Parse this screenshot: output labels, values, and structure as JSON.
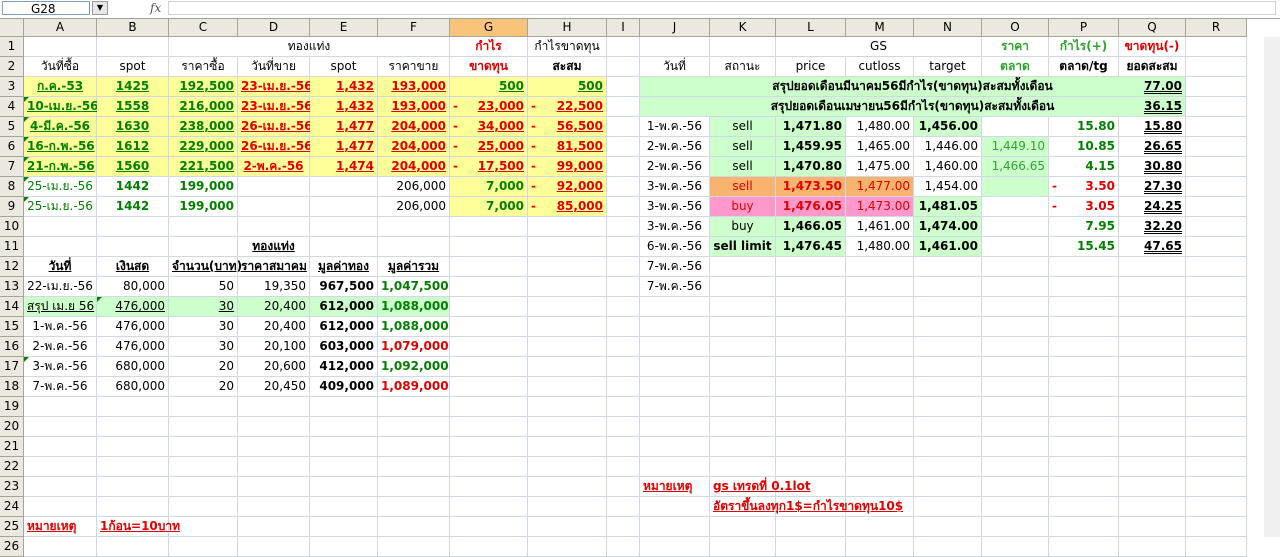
{
  "namebox": "G28",
  "fx": "fx",
  "columns": [
    "A",
    "B",
    "C",
    "D",
    "E",
    "F",
    "G",
    "H",
    "I",
    "J",
    "K",
    "L",
    "M",
    "N",
    "O",
    "P",
    "Q",
    "R"
  ],
  "rows": [
    "1",
    "2",
    "3",
    "4",
    "5",
    "6",
    "7",
    "8",
    "9",
    "10",
    "11",
    "12",
    "13",
    "14",
    "15",
    "16",
    "17",
    "18",
    "19",
    "20",
    "21",
    "22",
    "23",
    "24",
    "25",
    "26"
  ],
  "cells": {
    "C1": "ทองแท่ง",
    "G1": "กำไร",
    "H1": "กำไรขาดทุน",
    "L1": "GS",
    "O1": "ราคา",
    "P1": "กำไร(+)",
    "Q1": "ขาดทุน(-)",
    "A2": "วันที่ซื้อ",
    "B2": "spot",
    "C2": "ราคาซื้อ",
    "D2": "วันที่ขาย",
    "E2": "spot",
    "F2": "ราคาขาย",
    "G2": "ขาดทุน",
    "H2": "สะสม",
    "J2": "วันที่",
    "K2": "สถานะ",
    "L2": "price",
    "M2": "cutloss",
    "N2": "target",
    "O2": "ตลาด",
    "P2": "ตลาด/tg",
    "Q2": "ยอดสะสม",
    "A3": "ก.ค.-53",
    "B3": "1425",
    "C3": "192,500",
    "D3": "23-เม.ย.-56",
    "E3": "1,432",
    "F3": "193,000",
    "G3": "500",
    "H3": "500",
    "J3": "สรุปยอดเดือนมีนาคม56มีกำไร(ขาดทุน)สะสมทั้งเดือน",
    "Q3": "77.00",
    "A4": "10-เม.ย.-56",
    "B4": "1558",
    "C4": "216,000",
    "D4": "23-เม.ย.-56",
    "E4": "1,432",
    "F4": "193,000",
    "G4a": "-",
    "G4": "23,000",
    "H4a": "-",
    "H4": "22,500",
    "J4": "สรุปยอดเดือนเมษายน56มีกำไร(ขาดทุน)สะสมทั้งเดือน",
    "Q4": "36.15",
    "A5": "4-มี.ค.-56",
    "B5": "1630",
    "C5": "238,000",
    "D5": "26-เม.ย.-56",
    "E5": "1,477",
    "F5": "204,000",
    "G5a": "-",
    "G5": "34,000",
    "H5a": "-",
    "H5": "56,500",
    "J5": "1-พ.ค.-56",
    "K5": "sell",
    "L5": "1,471.80",
    "M5": "1,480.00",
    "N5": "1,456.00",
    "P5": "15.80",
    "Q5": "15.80",
    "A6": "16-ก.พ.-56",
    "B6": "1612",
    "C6": "229,000",
    "D6": "26-เม.ย.-56",
    "E6": "1,477",
    "F6": "204,000",
    "G6a": "-",
    "G6": "25,000",
    "H6a": "-",
    "H6": "81,500",
    "J6": "2-พ.ค.-56",
    "K6": "sell",
    "L6": "1,459.95",
    "M6": "1,465.00",
    "N6": "1,446.00",
    "O6": "1,449.10",
    "P6": "10.85",
    "Q6": "26.65",
    "A7": "21-ก.พ.-56",
    "B7": "1560",
    "C7": "221,500",
    "D7": "2-พ.ค.-56",
    "E7": "1,474",
    "F7": "204,000",
    "G7a": "-",
    "G7": "17,500",
    "H7a": "-",
    "H7": "99,000",
    "J7": "2-พ.ค.-56",
    "K7": "sell",
    "L7": "1,470.80",
    "M7": "1,475.00",
    "N7": "1,460.00",
    "O7": "1,466.65",
    "P7": "4.15",
    "Q7": "30.80",
    "A8": "25-เม.ย.-56",
    "B8": "1442",
    "C8": "199,000",
    "F8": "206,000",
    "G8": "7,000",
    "H8a": "-",
    "H8": "92,000",
    "J8": "3-พ.ค.-56",
    "K8": "sell",
    "L8": "1,473.50",
    "M8": "1,477.00",
    "N8": "1,454.00",
    "P8a": "-",
    "P8": "3.50",
    "Q8": "27.30",
    "A9": "25-เม.ย.-56",
    "B9": "1442",
    "C9": "199,000",
    "F9": "206,000",
    "G9": "7,000",
    "H9a": "-",
    "H9": "85,000",
    "J9": "3-พ.ค.-56",
    "K9": "buy",
    "L9": "1,476.05",
    "M9": "1,473.00",
    "N9": "1,481.05",
    "P9a": "-",
    "P9": "3.05",
    "Q9": "24.25",
    "J10": "3-พ.ค.-56",
    "K10": "buy",
    "L10": "1,466.05",
    "M10": "1,461.00",
    "N10": "1,474.00",
    "P10": "7.95",
    "Q10": "32.20",
    "D11": "ทองแท่ง",
    "J11": "6-พ.ค.-56",
    "K11": "sell limit",
    "L11": "1,476.45",
    "M11": "1,480.00",
    "N11": "1,461.00",
    "P11": "15.45",
    "Q11": "47.65",
    "A12": "วันที่",
    "B12": "เงินสด",
    "C12": "จำนวน(บาท)",
    "D12": "ราคาสมาคม",
    "E12": "มูลค่าทอง",
    "F12": "มูลค่ารวม",
    "J12": "7-พ.ค.-56",
    "A13": "22-เม.ย.-56",
    "B13": "80,000",
    "C13": "50",
    "D13": "19,350",
    "E13": "967,500",
    "F13": "1,047,500",
    "J13": "7-พ.ค.-56",
    "A14": "สรุป เม.ย 56",
    "B14": "476,000",
    "C14": "30",
    "D14": "20,400",
    "E14": "612,000",
    "F14": "1,088,000",
    "A15": "1-พ.ค.-56",
    "B15": "476,000",
    "C15": "30",
    "D15": "20,400",
    "E15": "612,000",
    "F15": "1,088,000",
    "A16": "2-พ.ค.-56",
    "B16": "476,000",
    "C16": "30",
    "D16": "20,100",
    "E16": "603,000",
    "F16": "1,079,000",
    "A17": "3-พ.ค.-56",
    "B17": "680,000",
    "C17": "20",
    "D17": "20,600",
    "E17": "412,000",
    "F17": "1,092,000",
    "A18": "7-พ.ค.-56",
    "B18": "680,000",
    "C18": "20",
    "D18": "20,450",
    "E18": "409,000",
    "F18": "1,089,000",
    "J23": "หมายเหตุ",
    "K23": "gs เทรดที่ 0.1lot",
    "K24": "อัตราขึ้นลงทุก1$=กำไรขาดทุน10$",
    "A25": "หมายเหตุ",
    "B25": "1ก้อน=10บาท"
  }
}
